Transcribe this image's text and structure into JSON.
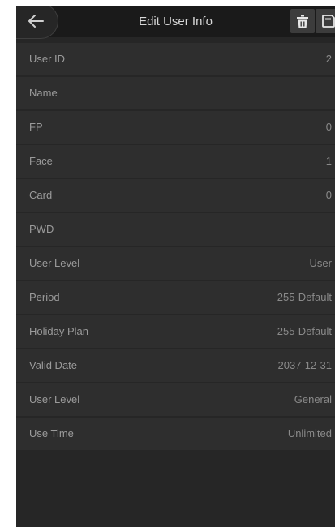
{
  "header": {
    "title": "Edit User Info",
    "back_icon": "arrow-left-icon",
    "delete_icon": "trash-icon",
    "save_icon": "save-icon"
  },
  "fields": [
    {
      "label": "User ID",
      "value": "2"
    },
    {
      "label": "Name",
      "value": ""
    },
    {
      "label": "FP",
      "value": "0"
    },
    {
      "label": "Face",
      "value": "1"
    },
    {
      "label": "Card",
      "value": "0"
    },
    {
      "label": "PWD",
      "value": ""
    },
    {
      "label": "User Level",
      "value": "User"
    },
    {
      "label": "Period",
      "value": "255-Default"
    },
    {
      "label": "Holiday Plan",
      "value": "255-Default"
    },
    {
      "label": "Valid Date",
      "value": "2037-12-31"
    },
    {
      "label": "User Level",
      "value": "General"
    },
    {
      "label": "Use Time",
      "value": "Unlimited"
    }
  ],
  "colors": {
    "background": "#262626",
    "row": "#2e2e2e",
    "header": "#1a1a1a",
    "text": "#9b9b9b"
  }
}
